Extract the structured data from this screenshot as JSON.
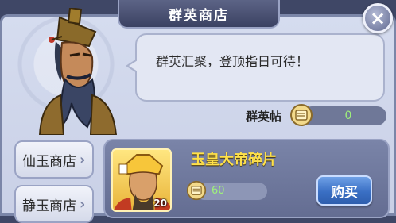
{
  "window": {
    "title": "群英商店"
  },
  "npc": {
    "dialogue": "群英汇聚，登顶指日可待！"
  },
  "currency": {
    "label": "群英帖",
    "amount": "0",
    "icon": "scroll-token-icon"
  },
  "tabs": [
    {
      "label": "仙玉商店"
    },
    {
      "label": "静玉商店"
    }
  ],
  "item": {
    "name": "玉皇大帝碎片",
    "count": "20",
    "price": "60",
    "buy_label": "购买"
  },
  "close_label": "×",
  "chevron": "›"
}
